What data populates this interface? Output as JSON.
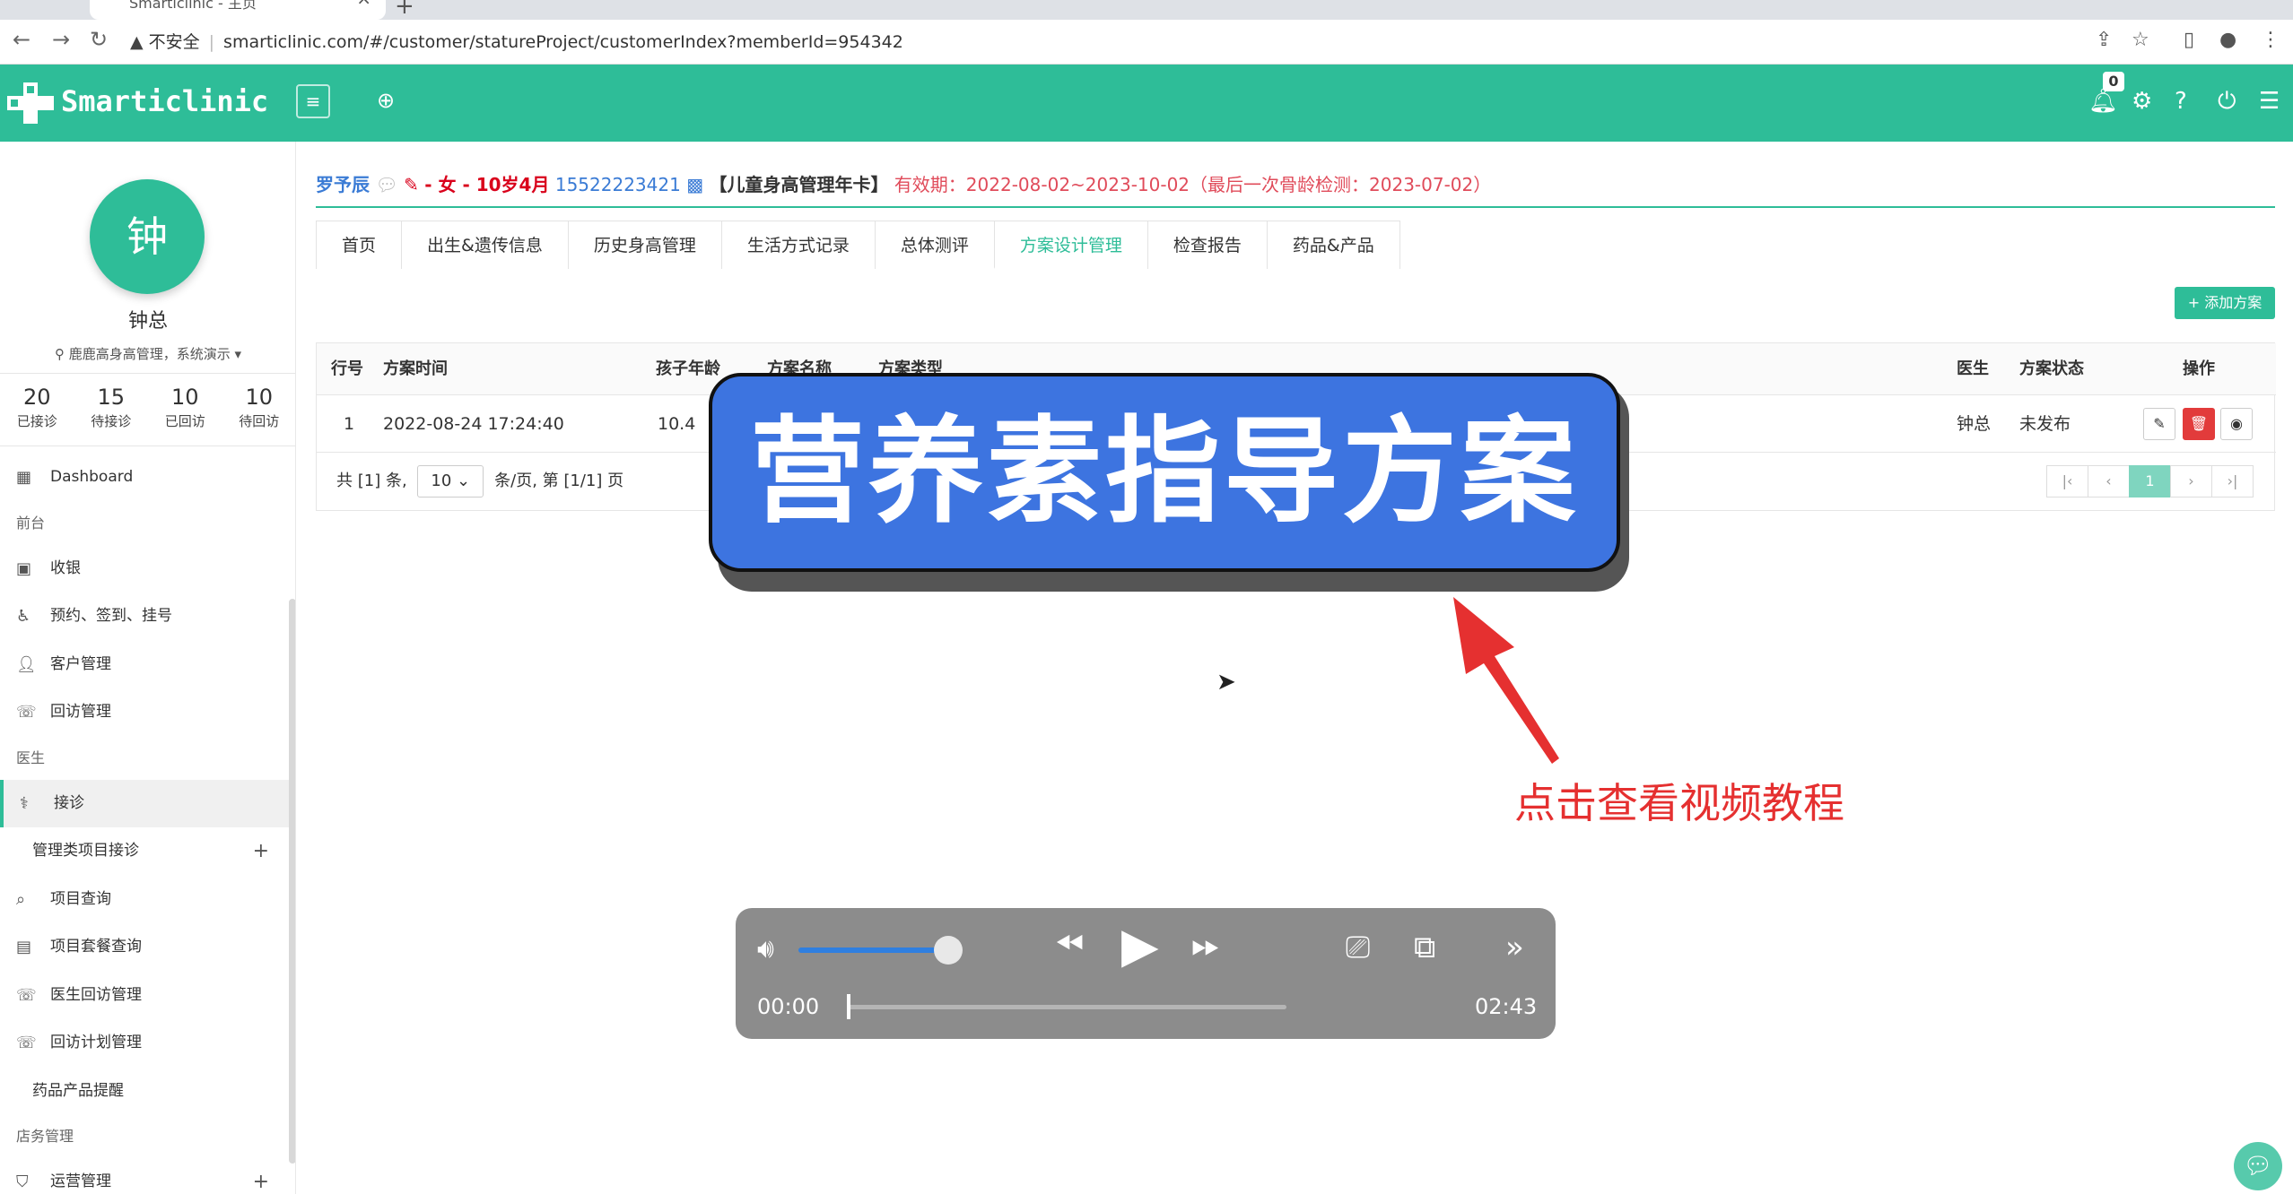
{
  "browser": {
    "tab_title": "Smarticlinic - 主页",
    "insecure_label": "不安全",
    "url": "smarticlinic.com/#/customer/statureProject/customerIndex?memberId=954342"
  },
  "header": {
    "logo_text": "Smarticlinic",
    "notification_count": "0"
  },
  "sidebar": {
    "avatar_char": "钟",
    "user_name": "钟总",
    "org": "鹿鹿高身高管理，系统演示",
    "stats": [
      {
        "num": "20",
        "label": "已接诊"
      },
      {
        "num": "15",
        "label": "待接诊"
      },
      {
        "num": "10",
        "label": "已回访"
      },
      {
        "num": "10",
        "label": "待回访"
      }
    ],
    "menu": {
      "dashboard": "Dashboard",
      "section_front": "前台",
      "cashier": "收银",
      "appointment": "预约、签到、挂号",
      "customers": "客户管理",
      "followup": "回访管理",
      "section_doctor": "医生",
      "reception": "接诊",
      "mgmt_reception": "管理类项目接诊",
      "project_query": "项目查询",
      "package_query": "项目套餐查询",
      "doctor_followup": "医生回访管理",
      "followup_plan": "回访计划管理",
      "drug_reminder": "药品产品提醒",
      "section_store": "店务管理",
      "operations": "运营管理"
    }
  },
  "patient": {
    "name": "罗予辰",
    "gender_age": "- 女 - 10岁4月",
    "phone": "15522223421",
    "card": "【儿童身高管理年卡】",
    "validity": "有效期：2022-08-02~2023-10-02（最后一次骨龄检测：2023-07-02）"
  },
  "tabs": [
    "首页",
    "出生&遗传信息",
    "历史身高管理",
    "生活方式记录",
    "总体测评",
    "方案设计管理",
    "检查报告",
    "药品&产品"
  ],
  "add_plan_label": "+ 添加方案",
  "table": {
    "headers": {
      "row_no": "行号",
      "plan_time": "方案时间",
      "child_age": "孩子年龄",
      "plan_name": "方案名称",
      "plan_type": "方案类型",
      "doctor": "医生",
      "status": "方案状态",
      "ops": "操作"
    },
    "rows": [
      {
        "row_no": "1",
        "plan_time": "2022-08-24 17:24:40",
        "child_age": "10.4",
        "doctor": "钟总",
        "status": "未发布"
      }
    ]
  },
  "pager": {
    "total_prefix": "共 [1] 条,",
    "page_size": "10",
    "per_page": "条/页,",
    "page_info": "第 [1/1] 页",
    "current_page": "1"
  },
  "overlay": {
    "banner_text": "营养素指导方案",
    "hint_text": "点击查看视频教程"
  },
  "player": {
    "current_time": "00:00",
    "duration": "02:43",
    "volume": 0.85,
    "progress": 0.0
  },
  "colors": {
    "brand": "#2ebd98",
    "banner": "#3d74e0",
    "hint": "#e53030",
    "delete": "#e23b3b"
  }
}
